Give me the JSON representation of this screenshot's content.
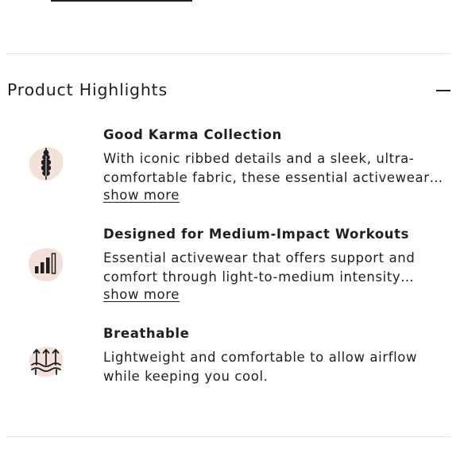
{
  "section": {
    "title": "Product Highlights",
    "collapse_icon": "minus-icon"
  },
  "colors": {
    "icon_blob": "#f1e1d8",
    "text": "#1f1f1f",
    "divider": "#e2e2e2"
  },
  "highlights": [
    {
      "icon": "leaf-icon",
      "title": "Good Karma Collection",
      "description": "With iconic ribbed details and a sleek, ultra-comfortable fabric, these essential activewear…",
      "link": "show more"
    },
    {
      "icon": "signal-bars-icon",
      "title": "Designed for Medium-Impact Workouts",
      "description": "Essential activewear that offers support and comfort through light-to-medium intensity…",
      "link": "show more"
    },
    {
      "icon": "airflow-icon",
      "title": "Breathable",
      "description": "Lightweight and comfortable to allow airflow while keeping you cool."
    }
  ]
}
